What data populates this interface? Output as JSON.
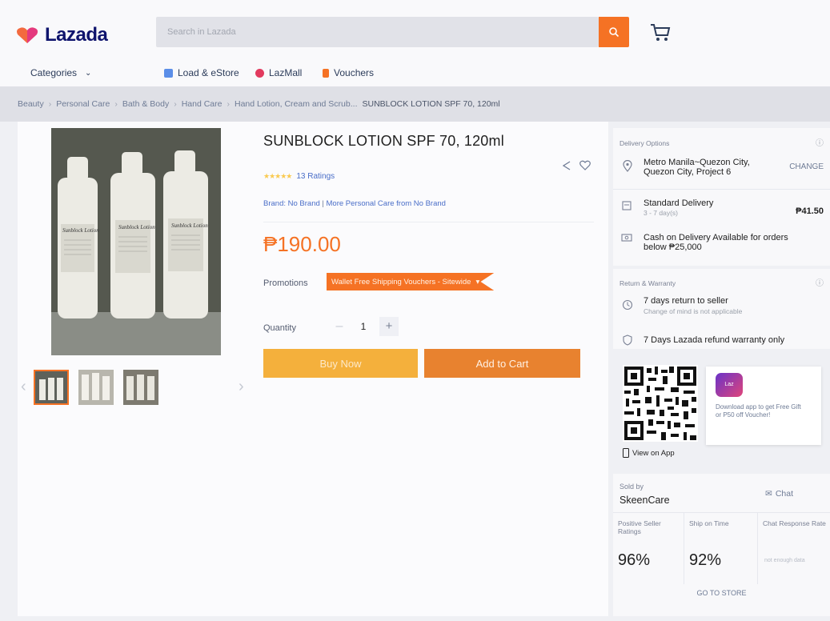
{
  "header": {
    "logo_text": "Lazada",
    "search_placeholder": "Search in Lazada",
    "nav": {
      "categories": "Categories",
      "load_estore": "Load & eStore",
      "lazmall": "LazMall",
      "vouchers": "Vouchers"
    }
  },
  "breadcrumb": [
    "Beauty",
    "Personal Care",
    "Bath & Body",
    "Hand Care",
    "Hand Lotion, Cream and Scrub...",
    "SUNBLOCK LOTION SPF 70, 120ml"
  ],
  "product": {
    "title": "SUNBLOCK LOTION SPF 70, 120ml",
    "ratings": "13 Ratings",
    "stars": 5,
    "brand_label": "Brand: No Brand",
    "brand_more": "More Personal Care from No Brand",
    "price": "₱190.00",
    "promotions_label": "Promotions",
    "promo_tag": "Wallet Free Shipping Vouchers - Sitewide",
    "quantity_label": "Quantity",
    "quantity": "1",
    "buy_now": "Buy Now",
    "add_to_cart": "Add to Cart",
    "bottle_label": "Sunblock Lotion"
  },
  "delivery": {
    "title": "Delivery Options",
    "location_line1": "Metro Manila~Quezon City,",
    "location_line2": "Quezon City, Project 6",
    "change": "CHANGE",
    "standard": "Standard Delivery",
    "standard_days": "3 - 7 day(s)",
    "standard_fee": "₱41.50",
    "cod_line1": "Cash on Delivery Available for orders",
    "cod_line2": "below ₱25,000"
  },
  "warranty": {
    "title": "Return & Warranty",
    "return_text": "7 days return to seller",
    "return_sub": "Change of mind is not applicable",
    "refund_text": "7 Days Lazada refund warranty only"
  },
  "app": {
    "view_on_app": "View on App",
    "icon_text": "Laz",
    "promo_text": "Download app to get Free Gift or P50 off Voucher!"
  },
  "seller": {
    "sold_by": "Sold by",
    "name": "SkeenCare",
    "chat": "Chat",
    "positive_label": "Positive Seller Ratings",
    "positive_value": "96%",
    "ship_label": "Ship on Time",
    "ship_value": "92%",
    "chat_label": "Chat Response Rate",
    "chat_value": "not enough data",
    "go_to_store": "GO TO STORE"
  },
  "colors": {
    "accent": "#f57224",
    "buy_now": "#f4b03c",
    "add_to_cart": "#e8822f",
    "logo": "#0f146d"
  }
}
